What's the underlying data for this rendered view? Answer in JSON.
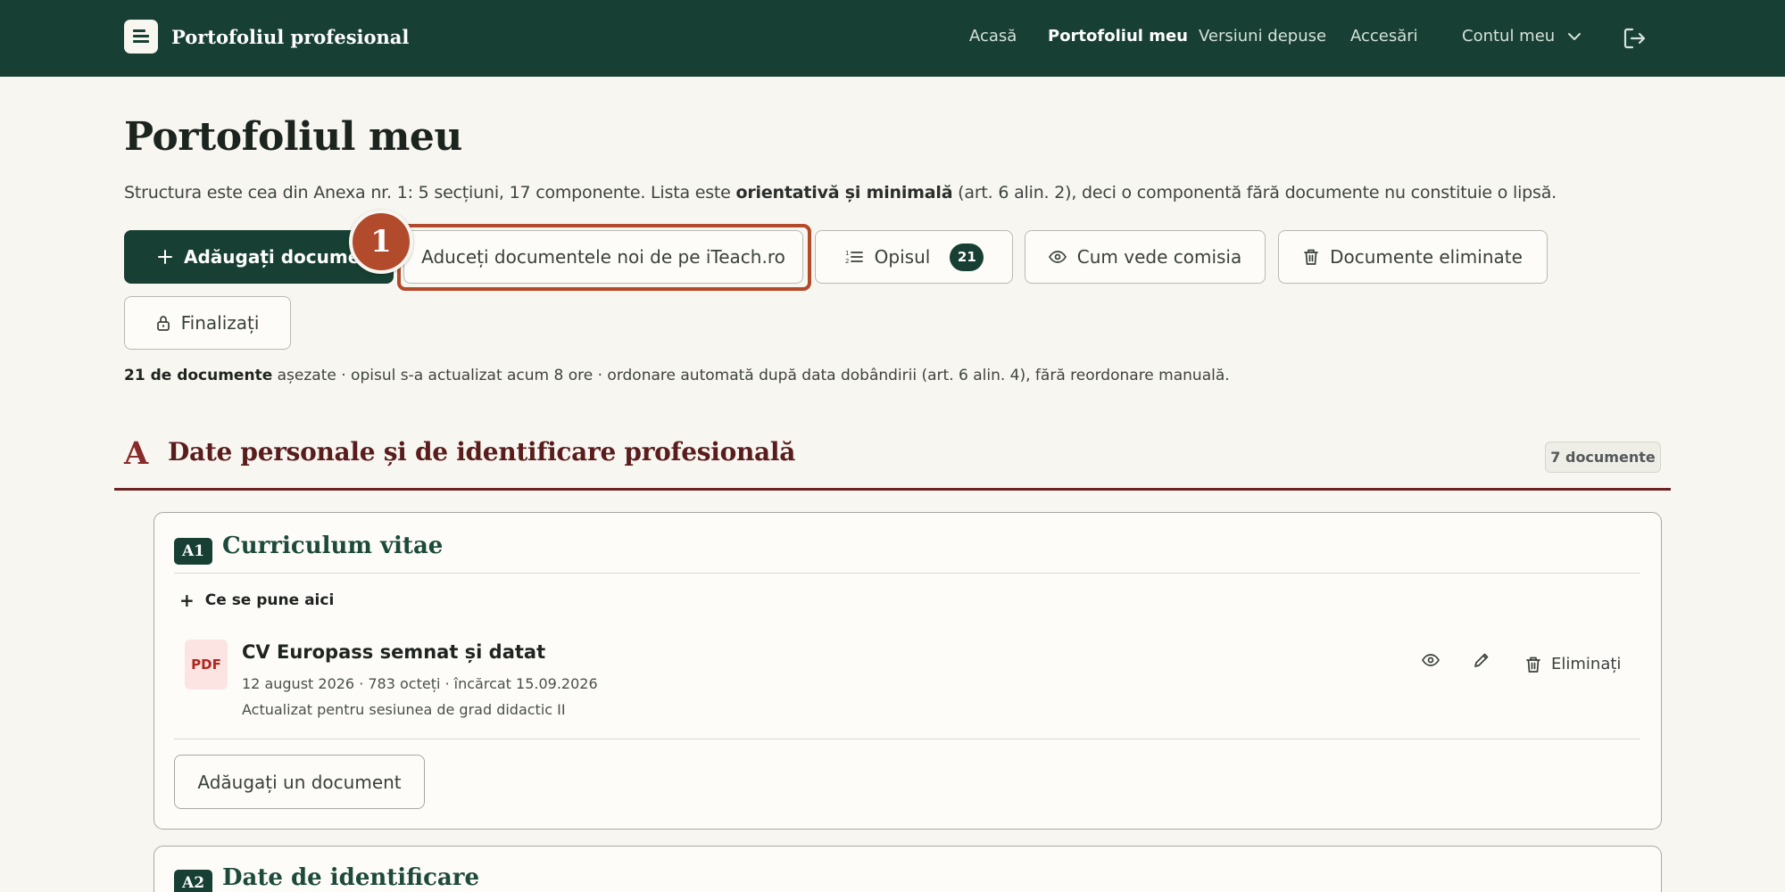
{
  "app": {
    "brand_title": "Portofoliul profesional",
    "nav": [
      {
        "label": "Acasă",
        "active": false
      },
      {
        "label": "Portofoliul meu",
        "active": true
      },
      {
        "label": "Versiuni depuse",
        "active": false
      },
      {
        "label": "Accesări",
        "active": false
      }
    ],
    "account_label": "Contul meu"
  },
  "page": {
    "title": "Portofoliul meu",
    "intro_start": "Structura este cea din Anexa nr. 1: 5 secțiuni, 17 componente. Lista este ",
    "intro_bold": "orientativă și minimală",
    "intro_end": " (art. 6 alin. 2), deci o componentă fără documente nu constituie o lipsă."
  },
  "toolbar": {
    "add_document": "Adăugați document",
    "import_iteach": "Aduceți documentele noi de pe iTeach.ro",
    "opis": "Opisul",
    "opis_count": "21",
    "committee_view": "Cum vede comisia",
    "removed_documents": "Documente eliminate",
    "finalize": "Finalizați",
    "step_marker": "1"
  },
  "summary": {
    "count_bold": "21 de documente",
    "rest": " așezate · opisul s-a actualizat acum 8 ore · ordonare automată după data dobândirii (art. 6 alin. 4), fără reordonare manuală."
  },
  "section": {
    "letter": "A",
    "title": "Date personale și de identificare profesională",
    "count": "7 documente"
  },
  "components": [
    {
      "code": "A1",
      "title": "Curriculum vitae",
      "help_label": "Ce se pune aici",
      "documents": [
        {
          "type": "PDF",
          "title": "CV Europass semnat și datat",
          "meta": "12 august 2026 · 783 octeți · încărcat 15.09.2026",
          "note": "Actualizat pentru sesiunea de grad didactic II",
          "remove_label": "Eliminați"
        }
      ],
      "add_label": "Adăugați un document"
    },
    {
      "code": "A2",
      "title": "Date de identificare"
    }
  ],
  "colors": {
    "brand": "#173f33",
    "section_accent": "#6e2323",
    "highlight": "#b24a2c"
  }
}
